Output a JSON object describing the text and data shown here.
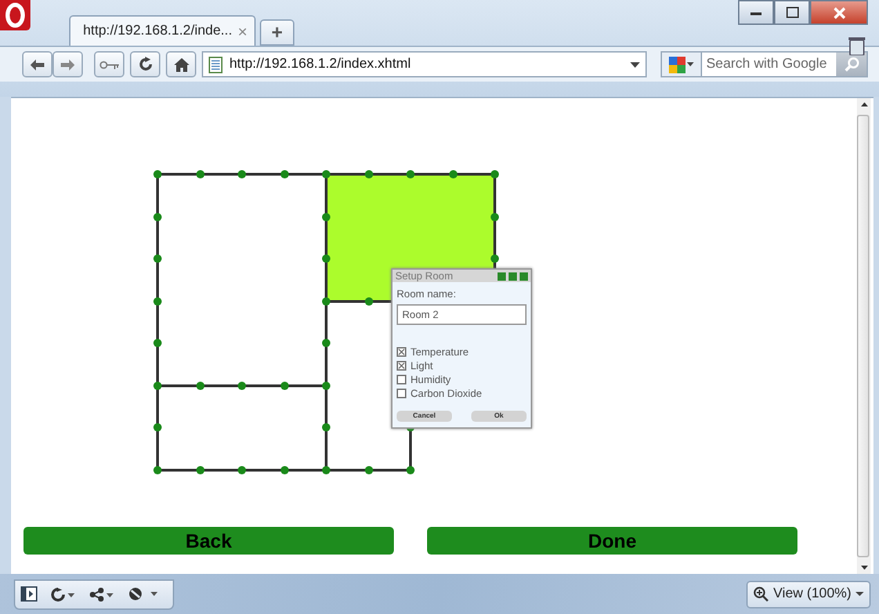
{
  "browser": {
    "tab_title": "http://192.168.1.2/inde...",
    "tab_close": "×",
    "new_tab": "+",
    "address": "http://192.168.1.2/index.xhtml",
    "search": {
      "placeholder": "Search with Google"
    }
  },
  "rooms": [
    {
      "selected": false
    },
    {
      "selected": true
    },
    {
      "selected": false
    },
    {
      "selected": false
    }
  ],
  "dialog": {
    "title": "Setup Room",
    "name_label": "Room name:",
    "name_value": "Room 2",
    "sensors": [
      {
        "label": "Temperature",
        "checked": true
      },
      {
        "label": "Light",
        "checked": true
      },
      {
        "label": "Humidity",
        "checked": false
      },
      {
        "label": "Carbon Dioxide",
        "checked": false
      }
    ],
    "buttons": [
      "Cancel",
      "Ok"
    ]
  },
  "buttons": [
    "Back",
    "Done"
  ],
  "status_bar": {
    "view": "View (100%)"
  }
}
